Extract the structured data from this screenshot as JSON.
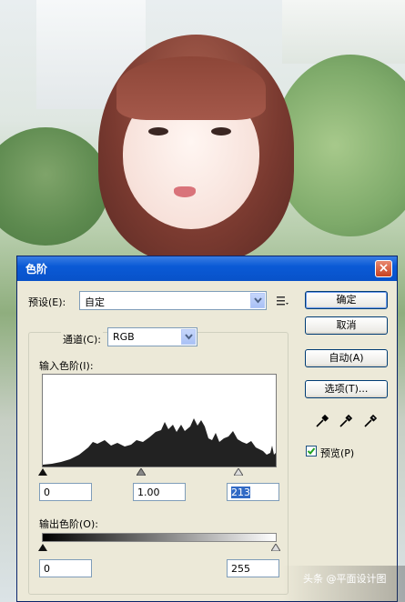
{
  "dialog": {
    "title": "色阶",
    "close_glyph": "×"
  },
  "preset": {
    "label": "预设(E):",
    "value": "自定"
  },
  "channel": {
    "label": "通道(C):",
    "value": "RGB"
  },
  "input_levels": {
    "label": "输入色阶(I):",
    "shadow": "0",
    "midtone": "1.00",
    "highlight": "213"
  },
  "output_levels": {
    "label": "输出色阶(O):",
    "shadow": "0",
    "highlight": "255"
  },
  "buttons": {
    "ok": "确定",
    "cancel": "取消",
    "auto": "自动(A)",
    "options": "选项(T)..."
  },
  "preview": {
    "label": "预览(P)",
    "checked": true
  },
  "watermark": "头条 @平面设计图",
  "icons": [
    "close-icon",
    "chevron-down-icon",
    "preset-menu-icon",
    "black-eyedropper-icon",
    "gray-eyedropper-icon",
    "white-eyedropper-icon",
    "checkmark-icon"
  ],
  "colors": {
    "title_bar": "#0a5ad6",
    "dialog_bg": "#ece9d8",
    "selection": "#316ac5"
  }
}
